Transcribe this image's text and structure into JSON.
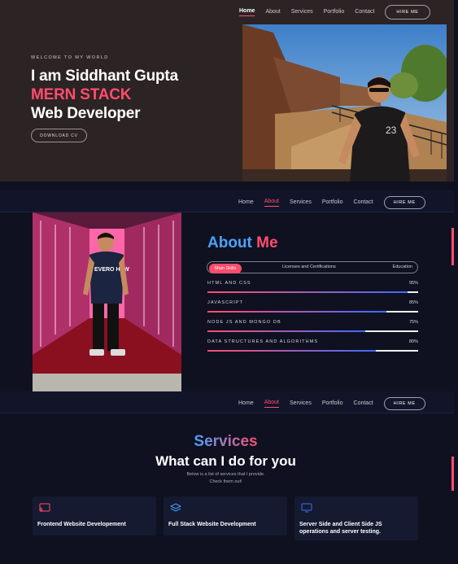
{
  "nav": {
    "items": [
      "Home",
      "About",
      "Services",
      "Portfolio",
      "Contact"
    ],
    "hire": "HIRE ME"
  },
  "hero": {
    "welcome": "WELCOME TO MY WORLD",
    "line1": "I am Siddhant Gupta",
    "line2": "MERN STACK",
    "line3": "Web Developer",
    "cta": "DOWNLOAD CV",
    "shirt_print": "23"
  },
  "about": {
    "title_main": "About",
    "title_accent": "Me",
    "tabs": [
      "Main Skills",
      "Licenses and Certifications",
      "Education"
    ],
    "skills": [
      {
        "name": "HTML AND CSS",
        "pct": "95%",
        "level": 0.95
      },
      {
        "name": "JAVASCRIPT",
        "pct": "85%",
        "level": 0.85
      },
      {
        "name": "NODE JS AND MONGO DB",
        "pct": "75%",
        "level": 0.75
      },
      {
        "name": "DATA STRUCTURES AND ALGORITHMS",
        "pct": "80%",
        "level": 0.8
      }
    ],
    "shirt_print": "EVERO HAW"
  },
  "services": {
    "title": "Services",
    "subtitle": "What can I do for you",
    "desc1": "Below is a list of services that I provide.",
    "desc2": "Check them out!",
    "cards": [
      {
        "title": "Frontend Website Developement",
        "icon": "cast-icon"
      },
      {
        "title": "Full Stack Website Development",
        "icon": "layers-icon"
      },
      {
        "title_line1": "Server Side and Client Side JS",
        "title_line2": "operations and server testing.",
        "icon": "monitor-icon"
      }
    ]
  },
  "colors": {
    "accent": "#ff4d6d",
    "blue": "#4aa3ff",
    "hero_bg": "#2c2324",
    "dark_bg": "#0f1120"
  }
}
